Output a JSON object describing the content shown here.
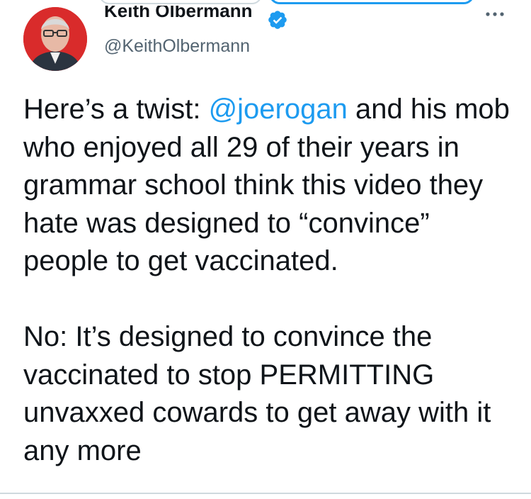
{
  "author": {
    "name": "Keith Olbermann",
    "handle": "@KeithOlbermann",
    "verified": true
  },
  "icons": {
    "verified": "verified-badge-icon",
    "more": "more-options-icon"
  },
  "tweet": {
    "p1_before": "Here’s a twist: ",
    "p1_mention": "@joerogan",
    "p1_after": " and his mob who enjoyed all 29 of their years in grammar school think this video they hate was designed to “convince” people to get vaccinated.",
    "p2": "No: It’s designed to convince the vaccinated to stop PERMITTING unvaxxed cowards to get away with it any more"
  },
  "colors": {
    "accent": "#1d9bf0",
    "text": "#0f1419",
    "secondary": "#536471"
  }
}
